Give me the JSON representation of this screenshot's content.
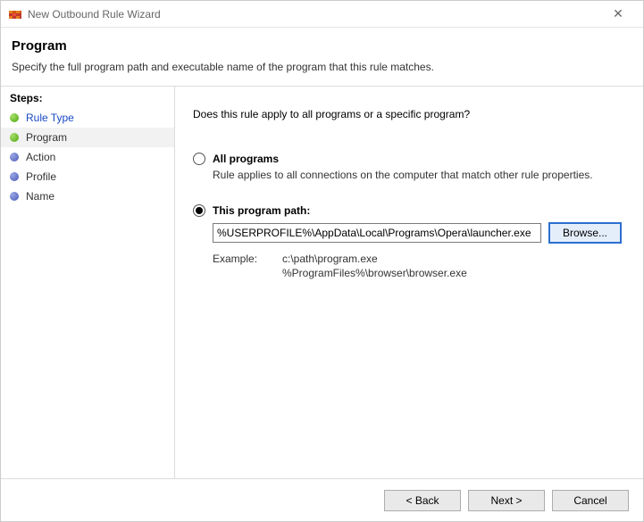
{
  "window": {
    "title": "New Outbound Rule Wizard"
  },
  "header": {
    "title": "Program",
    "subtitle": "Specify the full program path and executable name of the program that this rule matches."
  },
  "sidebar": {
    "label": "Steps:",
    "steps": [
      {
        "label": "Rule Type"
      },
      {
        "label": "Program"
      },
      {
        "label": "Action"
      },
      {
        "label": "Profile"
      },
      {
        "label": "Name"
      }
    ]
  },
  "main": {
    "question": "Does this rule apply to all programs or a specific program?",
    "option_all": {
      "label": "All programs",
      "desc": "Rule applies to all connections on the computer that match other rule properties."
    },
    "option_path": {
      "label": "This program path:",
      "value": "%USERPROFILE%\\AppData\\Local\\Programs\\Opera\\launcher.exe",
      "browse": "Browse..."
    },
    "example": {
      "label": "Example:",
      "line1": "c:\\path\\program.exe",
      "line2": "%ProgramFiles%\\browser\\browser.exe"
    }
  },
  "footer": {
    "back": "< Back",
    "next": "Next >",
    "cancel": "Cancel"
  }
}
